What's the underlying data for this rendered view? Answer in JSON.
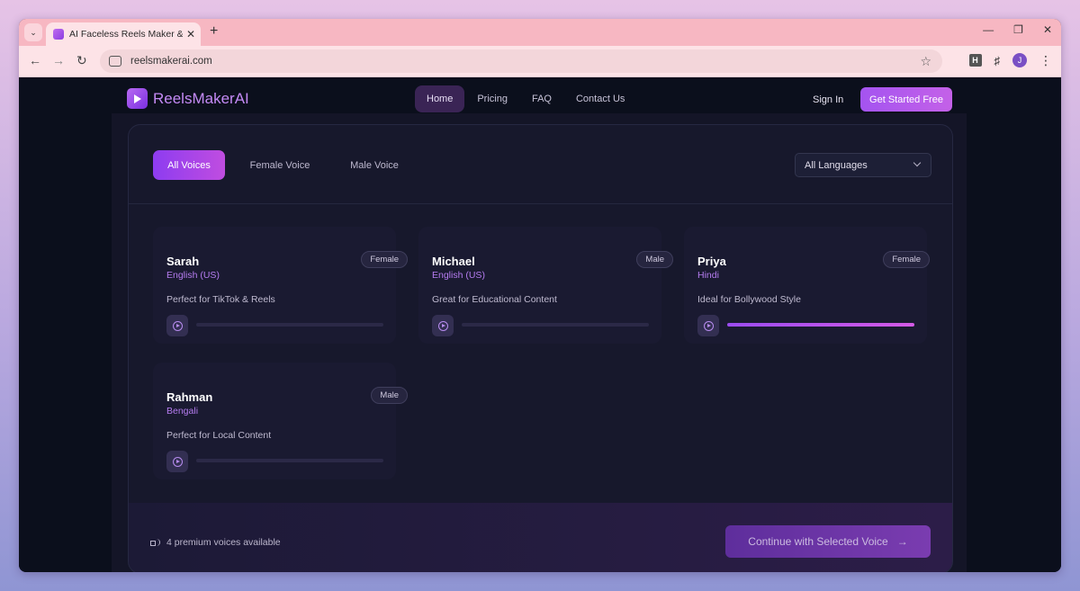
{
  "browser": {
    "tab_title": "AI Faceless Reels Maker & Auto",
    "url": "reelsmakerai.com",
    "profile_initial": "J",
    "extension_letter": "H"
  },
  "nav": {
    "logo": "ReelsMakerAI",
    "links": [
      "Home",
      "Pricing",
      "FAQ",
      "Contact Us"
    ],
    "active_link": "Home",
    "sign_in": "Sign In",
    "cta": "Get Started Free"
  },
  "filters": {
    "tabs": [
      "All Voices",
      "Female Voice",
      "Male Voice"
    ],
    "active_tab": "All Voices",
    "language": "All Languages"
  },
  "voices": [
    {
      "name": "Sarah",
      "language": "English (US)",
      "gender": "Female",
      "description": "Perfect for TikTok & Reels",
      "progress": 0
    },
    {
      "name": "Michael",
      "language": "English (US)",
      "gender": "Male",
      "description": "Great for Educational Content",
      "progress": 0
    },
    {
      "name": "Priya",
      "language": "Hindi",
      "gender": "Female",
      "description": "Ideal for Bollywood Style",
      "progress": 1.0
    },
    {
      "name": "Rahman",
      "language": "Bengali",
      "gender": "Male",
      "description": "Perfect for Local Content",
      "progress": 0
    }
  ],
  "footer": {
    "info": "4 premium voices available",
    "continue": "Continue with Selected Voice"
  },
  "colors": {
    "accent": "#a454f0",
    "page_bg": "#0b0f1c",
    "panel_bg": "#17182c",
    "tab_strip": "#f7b7c2"
  }
}
